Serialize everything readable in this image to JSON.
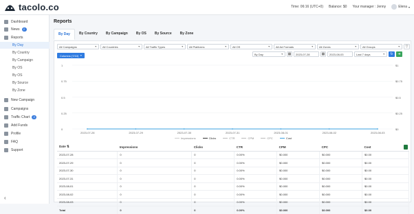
{
  "brand": {
    "name": "tacolo.co"
  },
  "topbar": {
    "time": "Time: 06:16 (UTC+0)",
    "balance": "Balance: $0",
    "manager": "Your manager : Jenny",
    "user": "Elena"
  },
  "sidebar": {
    "items": [
      {
        "label": "Dashboard",
        "icon": "dashboard-icon"
      },
      {
        "label": "News",
        "icon": "news-icon",
        "badge": "2"
      },
      {
        "label": "Reports",
        "icon": "reports-icon"
      },
      {
        "label": "By Day",
        "sub": true,
        "active": true
      },
      {
        "label": "By Country",
        "sub": true
      },
      {
        "label": "By Campaign",
        "sub": true
      },
      {
        "label": "By OS",
        "sub": true
      },
      {
        "label": "By OS",
        "sub": true
      },
      {
        "label": "By Source",
        "sub": true
      },
      {
        "label": "By Zone",
        "sub": true
      },
      {
        "label": "New Campaign",
        "icon": "plus-icon"
      },
      {
        "label": "Campaigns",
        "icon": "campaigns-icon"
      },
      {
        "label": "Traffic Chart",
        "icon": "traffic-chart-icon",
        "badge": "2"
      },
      {
        "label": "Add Funds",
        "icon": "wallet-icon"
      },
      {
        "label": "Profile",
        "icon": "profile-icon"
      },
      {
        "label": "FAQ",
        "icon": "faq-icon"
      },
      {
        "label": "Support",
        "icon": "support-icon"
      }
    ],
    "collapse": "‹"
  },
  "page": {
    "title": "Reports",
    "tabs": [
      "By Day",
      "By Country",
      "By Campaign",
      "By OS",
      "By Source",
      "By Zone"
    ]
  },
  "filters": {
    "row1": [
      "All Campaigns",
      "All Countries",
      "All Traffic Types",
      "All Platforms",
      "All OS",
      "All Ad Formats",
      "All Zones",
      "All Groups"
    ],
    "group_by": "By Day",
    "date_from": "2023-07-28",
    "date_to": "2023-08-03",
    "range": "Last 7 days",
    "columns_button": "Columns (7/10)"
  },
  "colors": {
    "accent": "#2f7be0",
    "green": "#3aa55d",
    "cost_line": "#3aa0e0"
  },
  "chart_data": {
    "type": "line",
    "x": [
      "2023-07-28",
      "2023-07-29",
      "2023-07-30",
      "2023-07-31",
      "2023-08-01",
      "2023-08-02",
      "2023-08-03"
    ],
    "series": [
      {
        "name": "Impressions",
        "values": [
          0,
          0,
          0,
          0,
          0,
          0,
          0
        ],
        "color": "#cccccc"
      },
      {
        "name": "Clicks",
        "values": [
          0,
          0,
          0,
          0,
          0,
          0,
          0
        ],
        "color": "#333333"
      },
      {
        "name": "CTR",
        "values": [
          0,
          0,
          0,
          0,
          0,
          0,
          0
        ],
        "color": "#bbbbbb"
      },
      {
        "name": "CPM",
        "values": [
          0,
          0,
          0,
          0,
          0,
          0,
          0
        ],
        "color": "#bbbbbb"
      },
      {
        "name": "CPC",
        "values": [
          0,
          0,
          0,
          0,
          0,
          0,
          0
        ],
        "color": "#bbbbbb"
      },
      {
        "name": "Cost",
        "values": [
          0,
          0,
          0,
          0,
          0,
          0,
          0
        ],
        "color": "#3aa0e0"
      }
    ],
    "yleft_ticks": [
      "1",
      "0.75",
      "0.5",
      "0.25",
      "0"
    ],
    "yright_ticks": [
      "$1",
      "$0.75",
      "$0.5",
      "$0.25",
      "$0"
    ],
    "ylim": [
      0,
      1
    ],
    "grid": true,
    "legend": "bottom"
  },
  "table": {
    "headers": [
      "Date",
      "Impressions",
      "Clicks",
      "CTR",
      "CPM",
      "CPC",
      "Cost"
    ],
    "rows": [
      [
        "2023-07-28",
        "0",
        "0",
        "0.00%",
        "$0.000",
        "$0.000",
        "$0.00"
      ],
      [
        "2023-07-29",
        "0",
        "0",
        "0.00%",
        "$0.000",
        "$0.000",
        "$0.00"
      ],
      [
        "2023-07-30",
        "0",
        "0",
        "0.00%",
        "$0.000",
        "$0.000",
        "$0.00"
      ],
      [
        "2023-07-31",
        "0",
        "0",
        "0.00%",
        "$0.000",
        "$0.000",
        "$0.00"
      ],
      [
        "2023-08-01",
        "0",
        "0",
        "0.00%",
        "$0.000",
        "$0.000",
        "$0.00"
      ],
      [
        "2023-08-02",
        "0",
        "0",
        "0.00%",
        "$0.000",
        "$0.000",
        "$0.00"
      ],
      [
        "2023-08-03",
        "0",
        "0",
        "0.00%",
        "$0.000",
        "$0.000",
        "$0.00"
      ]
    ],
    "total": [
      "Total",
      "0",
      "0",
      "0.00%",
      "$0.000",
      "$0.000",
      "$0.00"
    ]
  }
}
